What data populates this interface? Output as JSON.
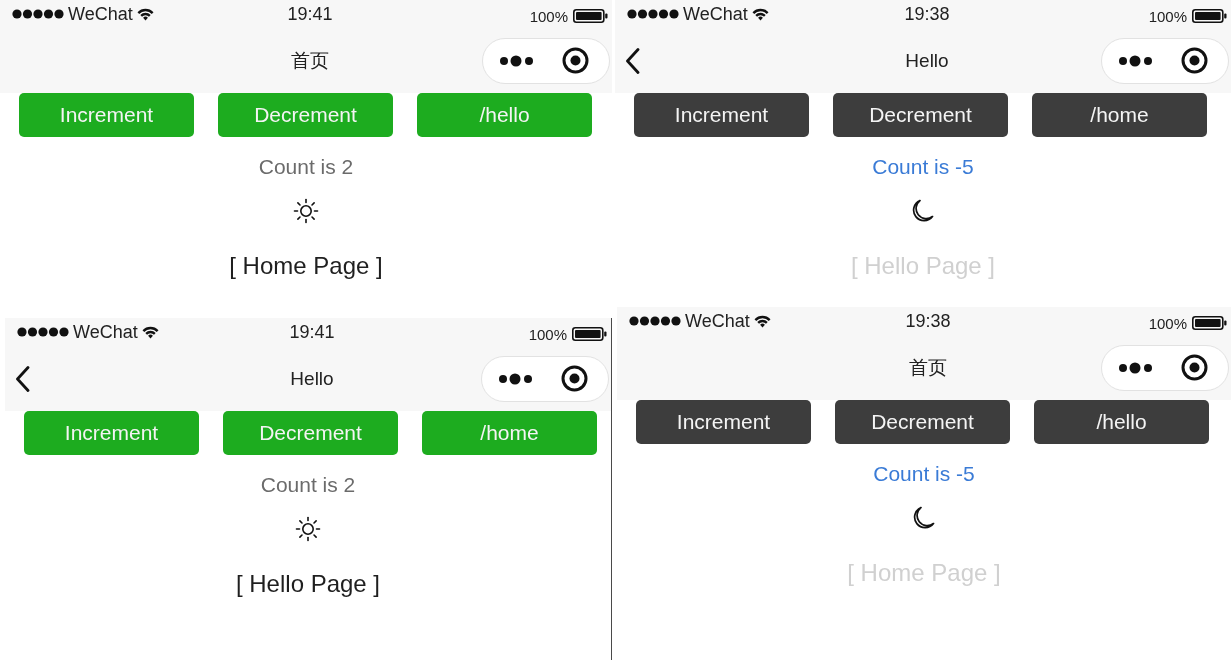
{
  "screens": [
    {
      "dark_mode": false,
      "status_bar": {
        "carrier": "WeChat",
        "time": "19:41",
        "battery": "100%"
      },
      "nav_bar": {
        "title": "首页",
        "back": false
      },
      "buttons": [
        "Increment",
        "Decrement",
        "/hello"
      ],
      "count": "Count is 2",
      "page_label": "[ Home Page ]"
    },
    {
      "dark_mode": false,
      "status_bar": {
        "carrier": "WeChat",
        "time": "19:41",
        "battery": "100%"
      },
      "nav_bar": {
        "title": "Hello",
        "back": true
      },
      "buttons": [
        "Increment",
        "Decrement",
        "/home"
      ],
      "count": "Count is 2",
      "page_label": "[ Hello Page ]"
    },
    {
      "dark_mode": true,
      "status_bar": {
        "carrier": "WeChat",
        "time": "19:38",
        "battery": "100%"
      },
      "nav_bar": {
        "title": "Hello",
        "back": true
      },
      "buttons": [
        "Increment",
        "Decrement",
        "/home"
      ],
      "count": "Count is -5",
      "page_label": "[ Hello Page ]"
    },
    {
      "dark_mode": true,
      "status_bar": {
        "carrier": "WeChat",
        "time": "19:38",
        "battery": "100%"
      },
      "nav_bar": {
        "title": "首页",
        "back": false
      },
      "buttons": [
        "Increment",
        "Decrement",
        "/hello"
      ],
      "count": "Count is -5",
      "page_label": "[ Home Page ]"
    }
  ]
}
